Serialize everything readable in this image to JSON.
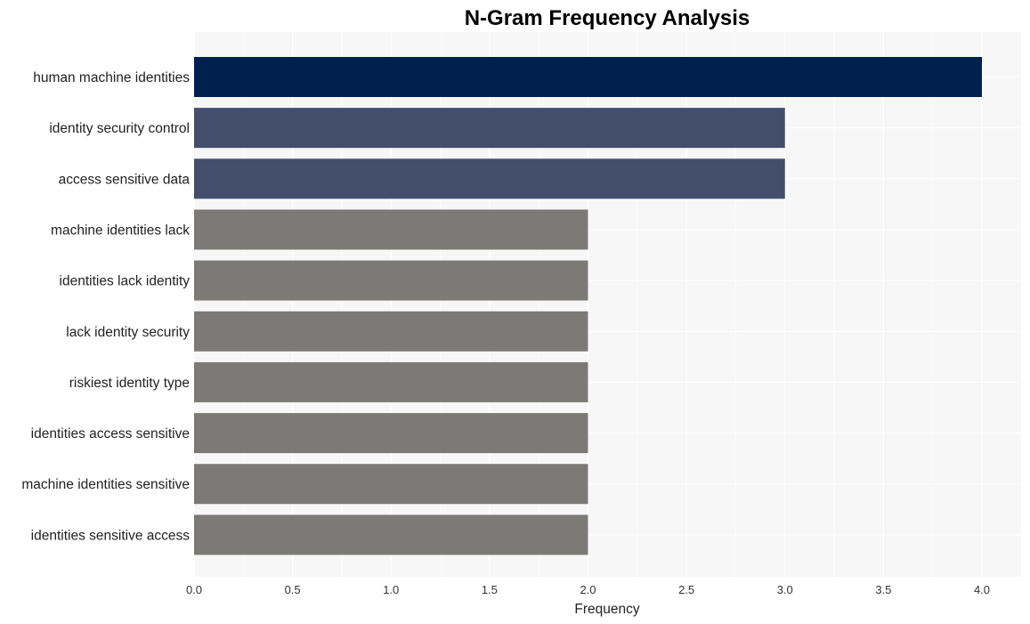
{
  "chart_data": {
    "type": "bar",
    "orientation": "horizontal",
    "title": "N-Gram Frequency Analysis",
    "xlabel": "Frequency",
    "ylabel": "",
    "xlim": [
      0,
      4.2
    ],
    "xticks": [
      "0.0",
      "0.5",
      "1.0",
      "1.5",
      "2.0",
      "2.5",
      "3.0",
      "3.5",
      "4.0"
    ],
    "grid": true,
    "categories": [
      "human machine identities",
      "identity security control",
      "access sensitive data",
      "machine identities lack",
      "identities lack identity",
      "lack identity security",
      "riskiest identity type",
      "identities access sensitive",
      "machine identities sensitive",
      "identities sensitive access"
    ],
    "values": [
      4,
      3,
      3,
      2,
      2,
      2,
      2,
      2,
      2,
      2
    ],
    "colors": [
      "#00214e",
      "#424e6b",
      "#424e6b",
      "#7b7a76",
      "#7b7a76",
      "#7b7a76",
      "#7b7a76",
      "#7b7a76",
      "#7b7a76",
      "#7b7a76"
    ],
    "plot_background": "#f7f7f7"
  }
}
